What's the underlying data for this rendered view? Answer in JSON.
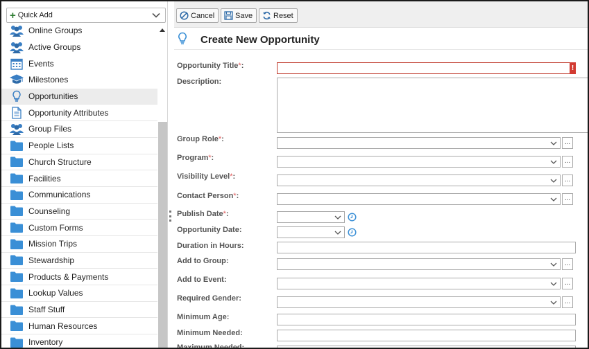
{
  "sidebar": {
    "quick_add_label": "Quick Add",
    "items": [
      {
        "label": "Online Groups",
        "icon": "people-icon"
      },
      {
        "label": "Active Groups",
        "icon": "people-icon"
      },
      {
        "label": "Events",
        "icon": "calendar-icon"
      },
      {
        "label": "Milestones",
        "icon": "graduation-cap-icon"
      },
      {
        "label": "Opportunities",
        "icon": "lightbulb-icon",
        "active": true
      },
      {
        "label": "Opportunity Attributes",
        "icon": "document-icon"
      },
      {
        "label": "Group Files",
        "icon": "people-icon"
      },
      {
        "label": "People Lists",
        "icon": "folder-icon"
      },
      {
        "label": "Church Structure",
        "icon": "folder-icon"
      },
      {
        "label": "Facilities",
        "icon": "folder-icon"
      },
      {
        "label": "Communications",
        "icon": "folder-icon"
      },
      {
        "label": "Counseling",
        "icon": "folder-icon"
      },
      {
        "label": "Custom Forms",
        "icon": "folder-icon"
      },
      {
        "label": "Mission Trips",
        "icon": "folder-icon"
      },
      {
        "label": "Stewardship",
        "icon": "folder-icon"
      },
      {
        "label": "Products & Payments",
        "icon": "folder-icon"
      },
      {
        "label": "Lookup Values",
        "icon": "folder-icon"
      },
      {
        "label": "Staff Stuff",
        "icon": "folder-icon"
      },
      {
        "label": "Human Resources",
        "icon": "folder-icon"
      },
      {
        "label": "Inventory",
        "icon": "folder-icon"
      }
    ]
  },
  "toolbar": {
    "cancel_label": "Cancel",
    "save_label": "Save",
    "reset_label": "Reset"
  },
  "form": {
    "title": "Create New Opportunity",
    "fields": {
      "opportunity_title": {
        "label": "Opportunity Title",
        "required_mark": "*",
        "suffix": ":",
        "value": "",
        "error_mark": "!"
      },
      "description": {
        "label": "Description:",
        "value": ""
      },
      "group_role": {
        "label": "Group Role",
        "required_mark": "*",
        "suffix": ":",
        "value": ""
      },
      "program": {
        "label": "Program",
        "required_mark": "*",
        "suffix": ":",
        "value": ""
      },
      "visibility_level": {
        "label": "Visibility Level",
        "required_mark": "*",
        "suffix": ":",
        "value": ""
      },
      "contact_person": {
        "label": "Contact Person",
        "required_mark": "*",
        "suffix": ":",
        "value": ""
      },
      "publish_date": {
        "label": "Publish Date",
        "required_mark": "*",
        "suffix": ":",
        "value": ""
      },
      "opportunity_date": {
        "label": "Opportunity Date:",
        "value": ""
      },
      "duration_hours": {
        "label": "Duration in Hours:",
        "value": ""
      },
      "add_to_group": {
        "label": "Add to Group:",
        "value": ""
      },
      "add_to_event": {
        "label": "Add to Event:",
        "value": ""
      },
      "required_gender": {
        "label": "Required Gender:",
        "value": ""
      },
      "minimum_age": {
        "label": "Minimum Age:",
        "value": ""
      },
      "minimum_needed": {
        "label": "Minimum Needed:",
        "value": ""
      },
      "maximum_needed": {
        "label": "Maximum Needed:",
        "value": ""
      }
    },
    "lookup_label": "..."
  },
  "colors": {
    "accent_blue": "#3a8fd6",
    "required_red": "#e05a5a",
    "error_red": "#d23b32",
    "active_item_bg": "#ececec"
  }
}
